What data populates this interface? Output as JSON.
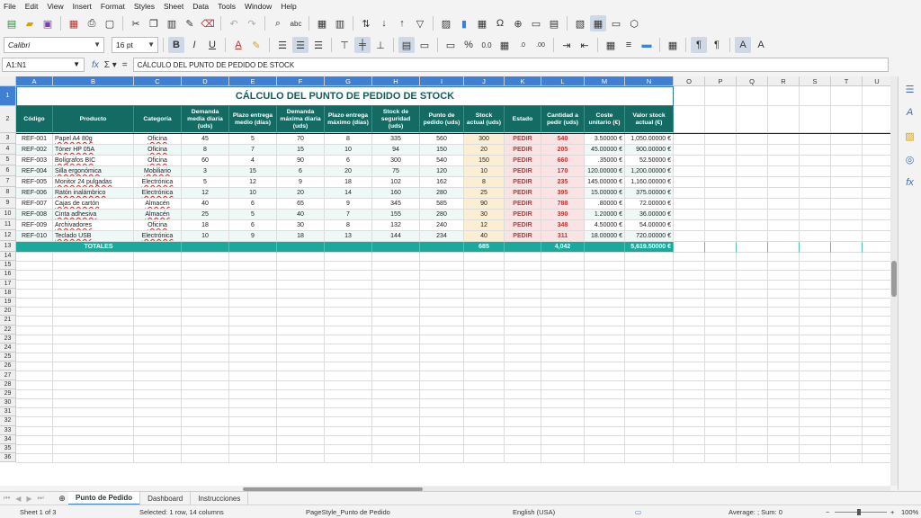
{
  "menu": [
    "File",
    "Edit",
    "View",
    "Insert",
    "Format",
    "Styles",
    "Sheet",
    "Data",
    "Tools",
    "Window",
    "Help"
  ],
  "toolbar": {
    "font_name": "Calibri",
    "font_size": "16 pt"
  },
  "formula": {
    "name_box": "A1:N1",
    "content": "CÁLCULO DEL PUNTO DE PEDIDO DE STOCK"
  },
  "columns": [
    "A",
    "B",
    "C",
    "D",
    "E",
    "F",
    "G",
    "H",
    "I",
    "J",
    "K",
    "L",
    "M",
    "N",
    "O",
    "P",
    "Q",
    "R",
    "S",
    "T",
    "U"
  ],
  "title": "CÁLCULO DEL PUNTO DE PEDIDO DE STOCK",
  "headers": [
    "Código",
    "Producto",
    "Categoría",
    "Demanda media diaria (uds)",
    "Plazo entrega medio (días)",
    "Demanda máxima diaria (uds)",
    "Plazo entrega máximo (días)",
    "Stock de seguridad (uds)",
    "Punto de pedido (uds)",
    "Stock actual (uds)",
    "Estado",
    "Cantidad a pedir (uds)",
    "Coste unitario (€)",
    "Valor stock actual (€)"
  ],
  "rows": [
    [
      "REF-001",
      "Papel A4 80g",
      "Oficina",
      "45",
      "5",
      "70",
      "8",
      "335",
      "560",
      "300",
      "PEDIR",
      "540",
      "3.50000 €",
      "1,050.00000 €"
    ],
    [
      "REF-002",
      "Tóner HP 05A",
      "Oficina",
      "8",
      "7",
      "15",
      "10",
      "94",
      "150",
      "20",
      "PEDIR",
      "205",
      "45.00000 €",
      "900.00000 €"
    ],
    [
      "REF-003",
      "Bolígrafos BIC",
      "Oficina",
      "60",
      "4",
      "90",
      "6",
      "300",
      "540",
      "150",
      "PEDIR",
      "660",
      ".35000 €",
      "52.50000 €"
    ],
    [
      "REF-004",
      "Silla ergonómica",
      "Mobiliario",
      "3",
      "15",
      "6",
      "20",
      "75",
      "120",
      "10",
      "PEDIR",
      "170",
      "120.00000 €",
      "1,200.00000 €"
    ],
    [
      "REF-005",
      "Monitor 24 pulgadas",
      "Electrónica",
      "5",
      "12",
      "9",
      "18",
      "102",
      "162",
      "8",
      "PEDIR",
      "235",
      "145.00000 €",
      "1,160.00000 €"
    ],
    [
      "REF-006",
      "Ratón inalámbrico",
      "Electrónica",
      "12",
      "10",
      "20",
      "14",
      "160",
      "280",
      "25",
      "PEDIR",
      "395",
      "15.00000 €",
      "375.00000 €"
    ],
    [
      "REF-007",
      "Cajas de cartón",
      "Almacén",
      "40",
      "6",
      "65",
      "9",
      "345",
      "585",
      "90",
      "PEDIR",
      "788",
      ".80000 €",
      "72.00000 €"
    ],
    [
      "REF-008",
      "Cinta adhesiva",
      "Almacén",
      "25",
      "5",
      "40",
      "7",
      "155",
      "280",
      "30",
      "PEDIR",
      "390",
      "1.20000 €",
      "36.00000 €"
    ],
    [
      "REF-009",
      "Archivadores",
      "Oficina",
      "18",
      "6",
      "30",
      "8",
      "132",
      "240",
      "12",
      "PEDIR",
      "348",
      "4.50000 €",
      "54.00000 €"
    ],
    [
      "REF-010",
      "Teclado USB",
      "Electrónica",
      "10",
      "9",
      "18",
      "13",
      "144",
      "234",
      "40",
      "PEDIR",
      "311",
      "18.00000 €",
      "720.00000 €"
    ]
  ],
  "totals": {
    "label": "TOTALES",
    "stock": "685",
    "pedir": "4,042",
    "valor": "5,619.50000 €"
  },
  "tabs": [
    "Punto de Pedido",
    "Dashboard",
    "Instrucciones"
  ],
  "status": {
    "sheet": "Sheet 1 of 3",
    "selection": "Selected: 1 row, 14 columns",
    "pagestyle": "PageStyle_Punto de Pedido",
    "language": "English (USA)",
    "summary": "Average: ; Sum: 0",
    "zoom": "100%"
  },
  "icons": [
    "new-icon",
    "open-icon",
    "save-icon",
    "export-pdf-icon",
    "print-icon",
    "print-preview-icon",
    "cut-icon",
    "copy-icon",
    "paste-icon",
    "clone-icon",
    "clear-icon",
    "undo-icon",
    "redo-icon",
    "find-icon",
    "spelling-icon",
    "row-icon",
    "column-icon",
    "sort-icon",
    "sort-ascending-icon",
    "sort-descending-icon",
    "autofilter-icon",
    "image-icon",
    "chart-icon",
    "pivot-icon",
    "special-character-icon",
    "hyperlink-icon",
    "comment-icon",
    "header-footer-icon",
    "define-print-area-icon",
    "freeze-icon",
    "split-icon",
    "bold-icon",
    "italic-icon",
    "underline-icon",
    "font-color-icon",
    "highlight-icon",
    "align-left-icon",
    "align-center-icon",
    "align-right-icon",
    "align-top-icon",
    "align-middle-icon",
    "align-bottom-icon",
    "wrap-icon",
    "merge-icon",
    "currency-icon",
    "percent-icon",
    "number-format-icon",
    "date-icon",
    "decimal-add-icon",
    "decimal-remove-icon",
    "indent-increase-icon",
    "indent-decrease-icon",
    "borders-icon",
    "border-style-icon",
    "border-color-icon",
    "conditional-icon",
    "ltr-icon",
    "rtl-icon",
    "properties-icon",
    "styles-icon",
    "gallery-icon",
    "navigator-icon",
    "functions-icon"
  ]
}
